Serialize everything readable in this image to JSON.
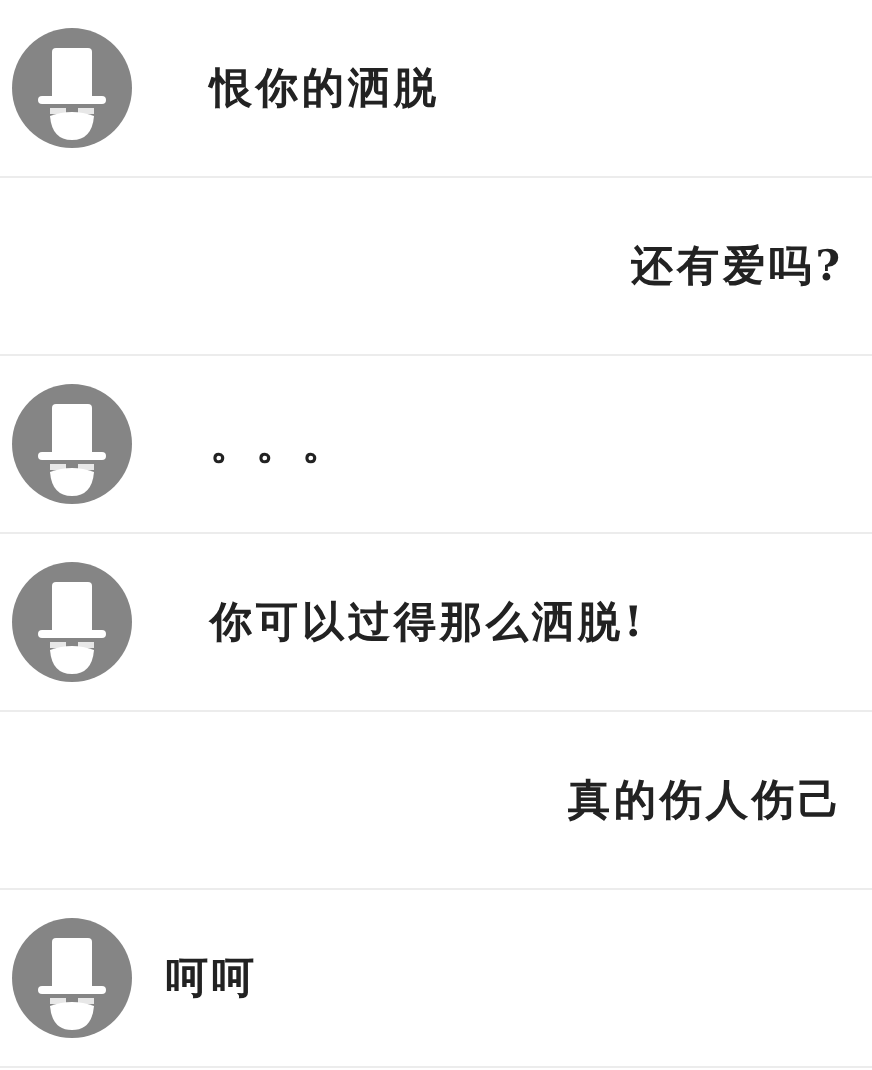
{
  "messages": [
    {
      "kind": "left",
      "text": "恨你的洒脱"
    },
    {
      "kind": "right",
      "text": "还有爱吗?"
    },
    {
      "kind": "left",
      "text": "。。。"
    },
    {
      "kind": "left",
      "text": "你可以过得那么洒脱!"
    },
    {
      "kind": "right",
      "text": "真的伤人伤己"
    },
    {
      "kind": "left_tight",
      "text": "呵呵"
    }
  ]
}
